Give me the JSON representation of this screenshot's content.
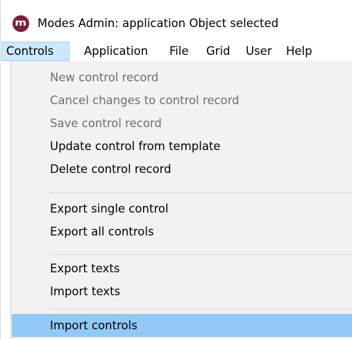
{
  "window": {
    "title": "Modes Admin: application Object selected",
    "icon_letter": "m",
    "icon_color": "#7b1f3a"
  },
  "menubar": {
    "items": [
      {
        "label": "Controls",
        "active": true
      },
      {
        "label": "Application"
      },
      {
        "label": "File"
      },
      {
        "label": "Grid"
      },
      {
        "label": "User"
      },
      {
        "label": "Help"
      }
    ]
  },
  "controls_menu": {
    "items": [
      {
        "label": "New control record",
        "enabled": false
      },
      {
        "label": "Cancel changes to control record",
        "enabled": false
      },
      {
        "label": "Save control record",
        "enabled": false
      },
      {
        "label": "Update control from template",
        "enabled": true
      },
      {
        "label": "Delete control record",
        "enabled": true
      },
      {
        "label": "Export single control",
        "enabled": true
      },
      {
        "label": "Export all controls",
        "enabled": true
      },
      {
        "label": "Export texts",
        "enabled": true
      },
      {
        "label": "Import texts",
        "enabled": true
      },
      {
        "label": "Import controls",
        "enabled": true,
        "highlighted": true
      }
    ]
  },
  "colors": {
    "menu_background": "#f2f2f2",
    "highlight": "#91c9f7",
    "active_menubar": "#cce8ff",
    "disabled_text": "#6d6d6d"
  }
}
